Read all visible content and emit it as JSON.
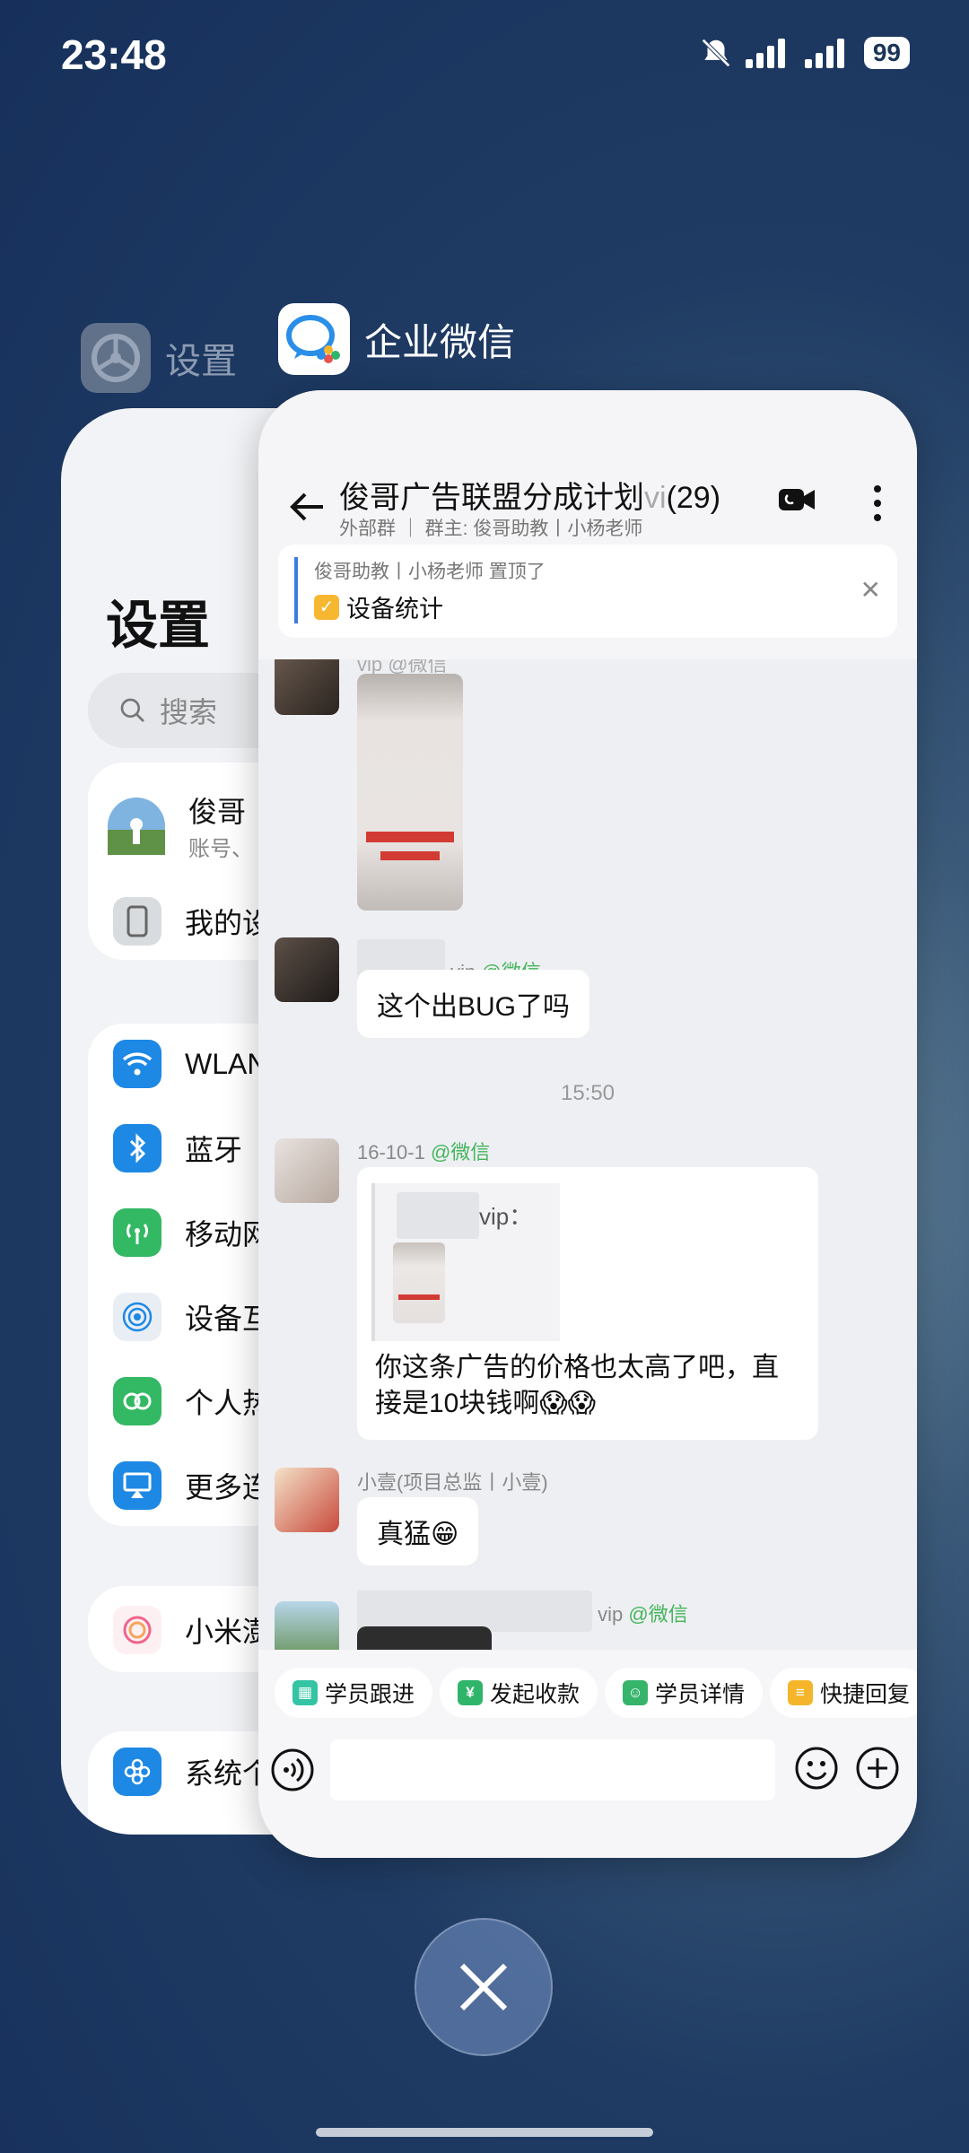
{
  "status_bar": {
    "time": "23:48",
    "battery": "99"
  },
  "settings_app": {
    "name": "设置",
    "page_title": "设置",
    "search_placeholder": "搜索",
    "account": {
      "name": "俊哥",
      "sub": "账号、"
    },
    "rows": [
      {
        "label": "我的设",
        "icon": "phone-icon"
      },
      {
        "label": "WLAN",
        "icon": "wifi-icon"
      },
      {
        "label": "蓝牙",
        "icon": "bluetooth-icon"
      },
      {
        "label": "移动网",
        "icon": "cellular-icon"
      },
      {
        "label": "设备互",
        "icon": "device-link-icon"
      },
      {
        "label": "个人热",
        "icon": "hotspot-icon"
      },
      {
        "label": "更多连",
        "icon": "airplay-icon"
      },
      {
        "label": "小米澎",
        "icon": "hyperos-icon"
      },
      {
        "label": "系统个",
        "icon": "flower-icon"
      }
    ]
  },
  "wecom_app": {
    "name": "企业微信",
    "chat": {
      "title": "俊哥广告联盟分成计划",
      "title_fade": "vi",
      "member_count": "(29)",
      "subtitle": "外部群 ｜ 群主: 俊哥助教丨小杨老师"
    },
    "pinned": {
      "by": "俊哥助教丨小杨老师 置顶了",
      "title": "设备统计"
    },
    "messages": {
      "m1_sender": "vip @微信",
      "m2_sender_suffix": "vip",
      "m2_wx": "@微信",
      "m2_text": "这个出BUG了吗",
      "time": "15:50",
      "m3_sender": "16-10-1",
      "m3_wx": "@微信",
      "m3_quote": "vip：",
      "m3_text": "你这条广告的价格也太高了吧，直接是10块钱啊😱😱",
      "m4_sender": "小壹(项目总监丨小壹)",
      "m4_text": "真猛😁",
      "m5_sender_suffix": "vip",
      "m5_wx": "@微信"
    },
    "quick_replies": [
      {
        "label": "学员跟进",
        "color": "#34c4a3"
      },
      {
        "label": "发起收款",
        "color": "#2fb56a"
      },
      {
        "label": "学员详情",
        "color": "#35b46a"
      },
      {
        "label": "快捷回复",
        "color": "#f5b52b"
      }
    ]
  }
}
